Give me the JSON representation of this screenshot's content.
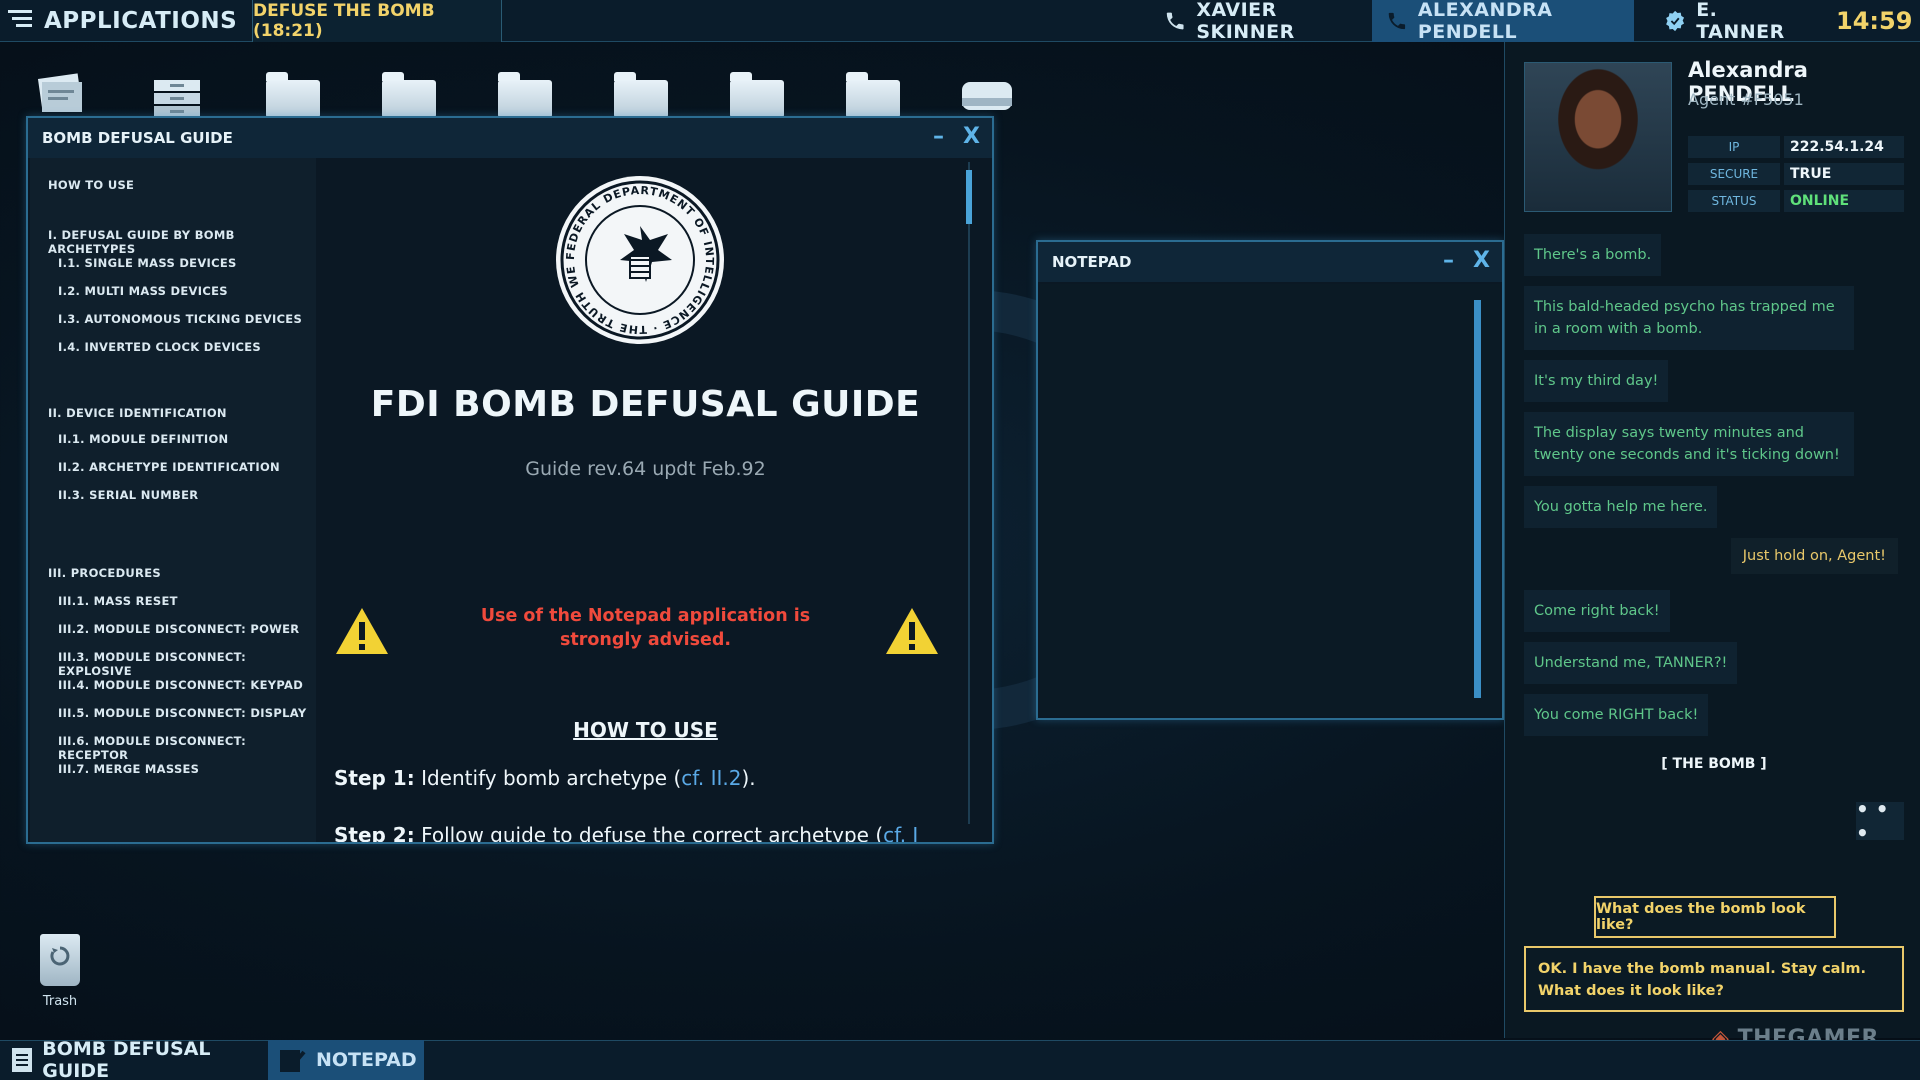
{
  "topbar": {
    "apps": "APPLICATIONS",
    "mission": "DEFUSE THE BOMB (18:21)",
    "contacts": [
      "XAVIER SKINNER",
      "ALEXANDRA PENDELL",
      "E. TANNER"
    ],
    "clock": "14:59"
  },
  "guide": {
    "title": "BOMB DEFUSAL GUIDE",
    "toc": [
      "HOW TO USE",
      "I. DEFUSAL GUIDE BY BOMB ARCHETYPES",
      "I.1. SINGLE MASS DEVICES",
      "I.2. MULTI MASS DEVICES",
      "I.3. AUTONOMOUS TICKING DEVICES",
      "I.4. INVERTED CLOCK DEVICES",
      "II. DEVICE IDENTIFICATION",
      "II.1. MODULE DEFINITION",
      "II.2. ARCHETYPE IDENTIFICATION",
      "II.3. SERIAL NUMBER",
      "III. PROCEDURES",
      "III.1. MASS RESET",
      "III.2. MODULE DISCONNECT: POWER",
      "III.3. MODULE DISCONNECT: EXPLOSIVE",
      "III.4. MODULE DISCONNECT: KEYPAD",
      "III.5. MODULE DISCONNECT: DISPLAY",
      "III.6. MODULE DISCONNECT: RECEPTOR",
      "III.7. MERGE MASSES"
    ],
    "seal_text": "FEDERAL DEPARTMENT OF INTELLIGENCE · THE TRUTH WE SEEK",
    "heading": "FDI BOMB DEFUSAL GUIDE",
    "revision": "Guide rev.64 updt Feb.92",
    "warning": "Use of the Notepad application is strongly advised.",
    "howto": "HOW TO USE",
    "step1_label": "Step 1:",
    "step1_text": " Identify bomb archetype (",
    "step1_link": "cf. II.2",
    "step1_end": ").",
    "step2_label": "Step 2:",
    "step2_text": " Follow guide to defuse the correct archetype (",
    "step2_link": "cf. I"
  },
  "notepad": {
    "title": "NOTEPAD"
  },
  "profile": {
    "name": "Alexandra PENDELL",
    "agent": "Agent #F5051",
    "ip_label": "IP",
    "ip": "222.54.1.24",
    "secure_label": "SECURE",
    "secure": "TRUE",
    "status_label": "STATUS",
    "status": "ONLINE"
  },
  "chat": [
    "There's a bomb.",
    "This bald-headed psycho has trapped me in a room with a bomb.",
    "It's my third day!",
    "The display says twenty minutes and twenty one seconds and it's ticking down!",
    "You gotta help me here.",
    "Just hold on, Agent!",
    "Come right back!",
    "Understand me, TANNER?!",
    "You come RIGHT back!"
  ],
  "the_bomb": "[   THE BOMB   ]",
  "typing": "• • •",
  "choices": [
    "What does the bomb look like?",
    "OK. I have the bomb manual. Stay calm. What does it look like?"
  ],
  "watermark": "THEGAMER",
  "desktop": {
    "trash": "Trash"
  },
  "taskbar": [
    "BOMB DEFUSAL GUIDE",
    "NOTEPAD"
  ],
  "colors": {
    "accent": "#2b6c91",
    "highlight": "#f2d36a",
    "warning": "#f04a3c",
    "online": "#5fc78a"
  }
}
